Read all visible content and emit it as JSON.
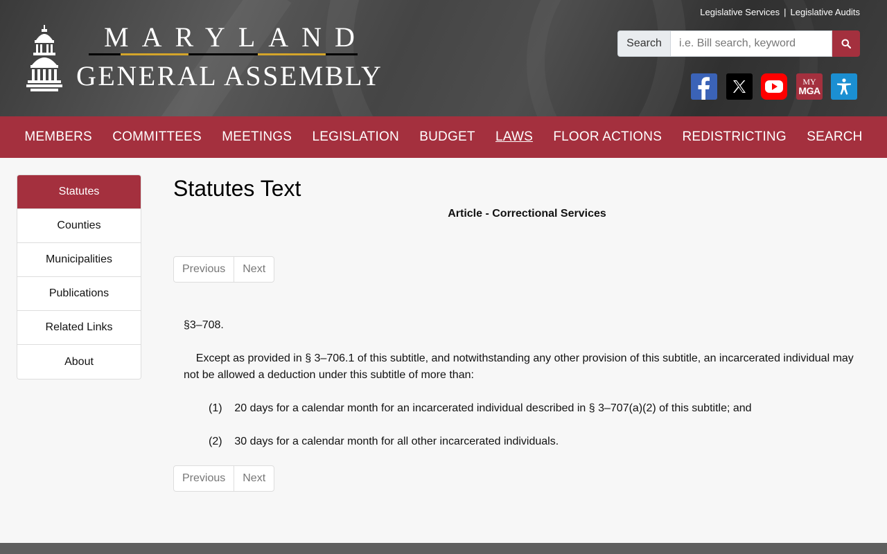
{
  "header": {
    "top_links": [
      "Legislative Services",
      "Legislative Audits"
    ],
    "top_links_separator": "|",
    "logo_line1": "MARYLAND",
    "logo_line2": "GENERAL ASSEMBLY",
    "search_label": "Search",
    "search_placeholder": "i.e. Bill search, keyword",
    "search_value": "",
    "social_icons": [
      "facebook-icon",
      "x-twitter-icon",
      "youtube-icon",
      "mymga-icon",
      "accessibility-icon"
    ],
    "mymga_text_top": "MY",
    "mymga_text_bottom": "MGA"
  },
  "nav": {
    "items": [
      "MEMBERS",
      "COMMITTEES",
      "MEETINGS",
      "LEGISLATION",
      "BUDGET",
      "LAWS",
      "FLOOR ACTIONS",
      "REDISTRICTING",
      "SEARCH"
    ],
    "active": "LAWS"
  },
  "sidebar": {
    "items": [
      "Statutes",
      "Counties",
      "Municipalities",
      "Publications",
      "Related Links",
      "About"
    ],
    "active": "Statutes"
  },
  "content": {
    "title": "Statutes Text",
    "article": "Article - Correctional Services",
    "pager_prev": "Previous",
    "pager_next": "Next",
    "section": "§3–708.",
    "paragraph": "Except as provided in § 3–706.1 of this subtitle, and notwithstanding any other provision of this subtitle, an incarcerated individual may not be allowed a deduction under this subtitle of more than:",
    "items": [
      {
        "num": "(1)",
        "text": "20 days for a calendar month for an incarcerated individual described in § 3–707(a)(2) of this subtitle; and"
      },
      {
        "num": "(2)",
        "text": "30 days for a calendar month for all other incarcerated individuals."
      }
    ]
  },
  "colors": {
    "brand": "#a4303e",
    "gold": "#d4a52a",
    "facebook": "#3b63b7",
    "accessibility": "#1b8fd2"
  }
}
